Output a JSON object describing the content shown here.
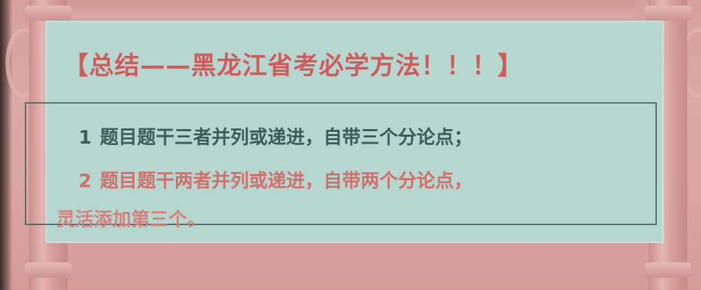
{
  "slide": {
    "title": "【总结——黑龙江省考必学方法！！！】",
    "items": [
      {
        "number": "1",
        "text": "题目题干三者并列或递进，自带三个分论点；"
      },
      {
        "number": "2",
        "text": "题目题干两者并列或递进，自带两个分论点，"
      }
    ],
    "continuation": "灵活添加第三个。"
  },
  "colors": {
    "panel_background": "#b5d7cf",
    "title": "#d25a5a",
    "item_1_text": "#3f5a57",
    "item_2_text": "#d46e6a",
    "frame_background": "#d9a3a1"
  }
}
